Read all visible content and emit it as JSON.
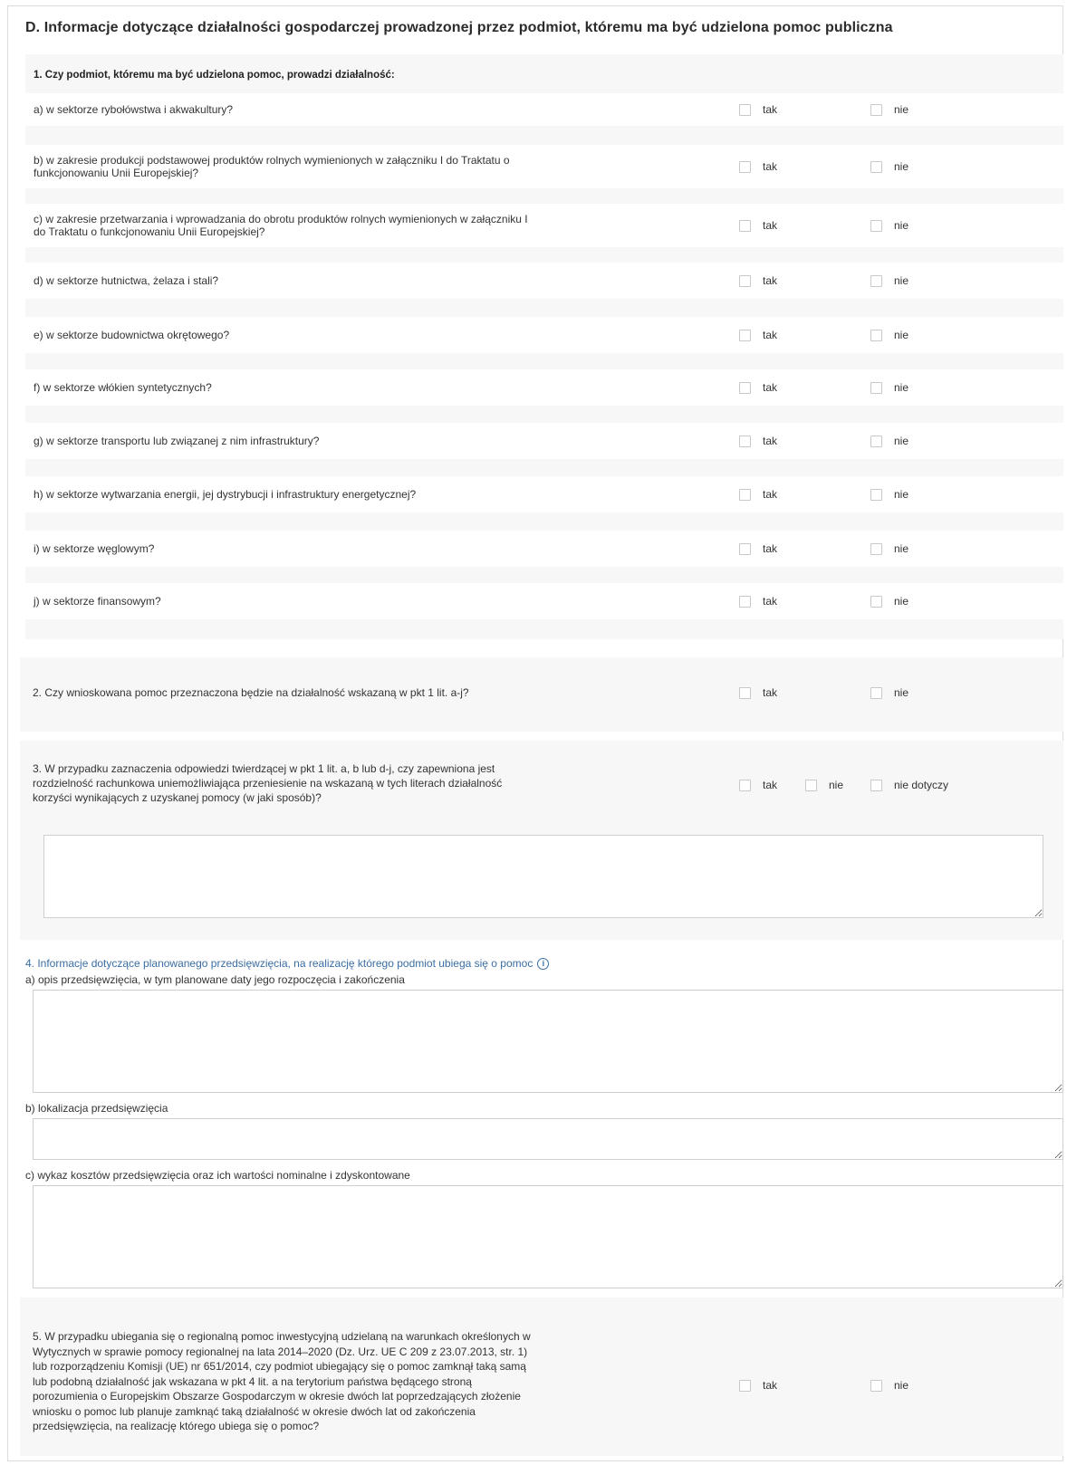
{
  "section": {
    "title": "D. Informacje dotyczące działalności gospodarczej prowadzonej przez podmiot, któremu ma być udzielona pomoc publiczna"
  },
  "options": {
    "yes": "tak",
    "no": "nie",
    "not_applicable": "nie dotyczy"
  },
  "q1": {
    "title": "1. Czy podmiot, któremu ma być udzielona pomoc, prowadzi działalność:",
    "items": [
      {
        "line1": "a) w sektorze rybołówstwa i akwakultury?",
        "line2": ""
      },
      {
        "line1": "b) w zakresie produkcji podstawowej produktów rolnych wymienionych w załączniku I do Traktatu o",
        "line2": "funkcjonowaniu Unii Europejskiej?"
      },
      {
        "line1": "c) w zakresie przetwarzania i wprowadzania do obrotu produktów rolnych wymienionych w załączniku I",
        "line2": "do Traktatu o funkcjonowaniu Unii Europejskiej?"
      },
      {
        "line1": "d) w sektorze hutnictwa, żelaza i stali?",
        "line2": ""
      },
      {
        "line1": "e) w sektorze budownictwa okrętowego?",
        "line2": ""
      },
      {
        "line1": "f) w sektorze włókien syntetycznych?",
        "line2": ""
      },
      {
        "line1": "g) w sektorze transportu lub związanej z nim infrastruktury?",
        "line2": ""
      },
      {
        "line1": "h) w sektorze wytwarzania energii, jej dystrybucji i infrastruktury energetycznej?",
        "line2": ""
      },
      {
        "line1": "i) w sektorze węglowym?",
        "line2": ""
      },
      {
        "line1": "j) w sektorze finansowym?",
        "line2": ""
      }
    ]
  },
  "q2": {
    "text": "2. Czy wnioskowana pomoc przeznaczona będzie na działalność wskazaną w pkt 1 lit. a-j?"
  },
  "q3": {
    "line1": "3. W przypadku zaznaczenia odpowiedzi twierdzącej w pkt 1 lit. a, b lub d-j, czy zapewniona jest",
    "line2": "rozdzielność rachunkowa uniemożliwiająca przeniesienie na wskazaną w tych literach działalność",
    "line3": "korzyści wynikających z uzyskanej pomocy (w jaki sposób)?",
    "textarea_value": ""
  },
  "q4": {
    "title": "4. Informacje dotyczące planowanego przedsięwzięcia, na realizację którego podmiot ubiega się o pomoc",
    "info_glyph": "i",
    "a_label": "a) opis przedsięwzięcia, w tym planowane daty jego rozpoczęcia i zakończenia",
    "a_value": "",
    "b_label": "b) lokalizacja przedsięwzięcia",
    "b_value": "",
    "c_label": "c) wykaz kosztów przedsięwzięcia oraz ich wartości nominalne i zdyskontowane",
    "c_value": ""
  },
  "q5": {
    "lines": [
      "5. W przypadku ubiegania się o regionalną pomoc inwestycyjną udzielaną na warunkach określonych w",
      "Wytycznych w sprawie pomocy regionalnej na lata 2014–2020 (Dz. Urz. UE C 209 z 23.07.2013, str. 1)",
      "lub rozporządzeniu Komisji (UE) nr 651/2014, czy podmiot ubiegający się o pomoc zamknął taką samą",
      "lub podobną działalność jak wskazana w pkt 4 lit. a na terytorium państwa będącego stroną",
      "porozumienia o Europejskim Obszarze Gospodarczym w okresie dwóch lat poprzedzających złożenie",
      "wniosku o pomoc lub planuje zamknąć taką działalność w okresie dwóch lat od zakończenia",
      "przedsięwzięcia, na realizację którego ubiega się o pomoc?"
    ]
  }
}
